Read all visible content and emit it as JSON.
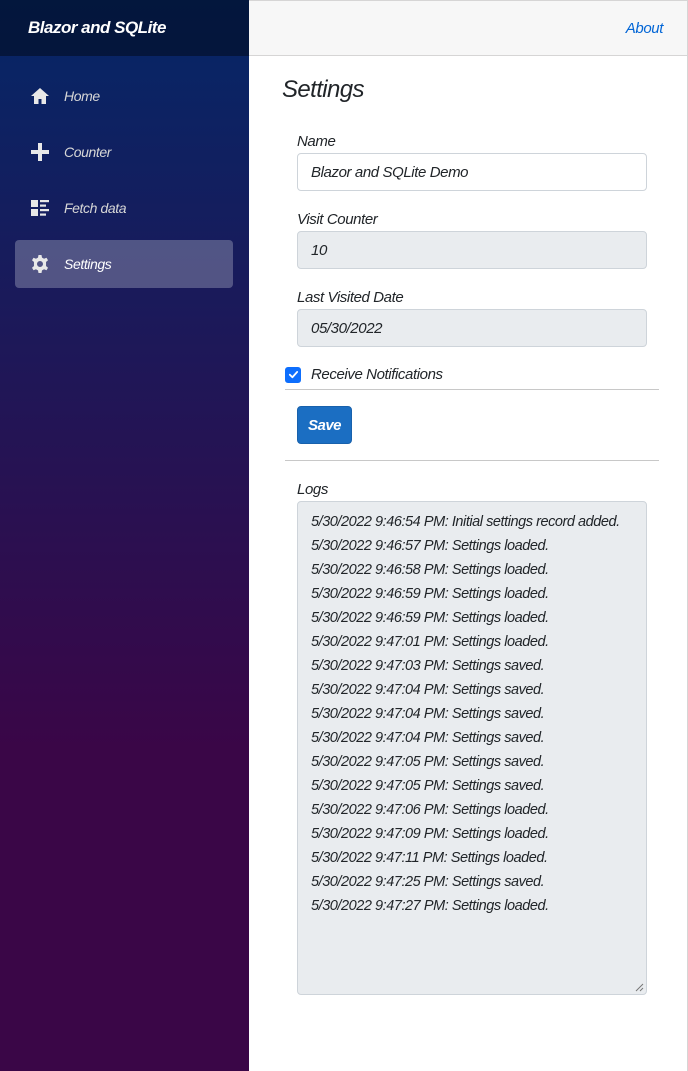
{
  "brand": "Blazor and SQLite",
  "nav": [
    {
      "label": "Home",
      "icon": "home-icon"
    },
    {
      "label": "Counter",
      "icon": "plus-icon"
    },
    {
      "label": "Fetch data",
      "icon": "list-rich-icon"
    },
    {
      "label": "Settings",
      "icon": "gear-icon",
      "active": true
    }
  ],
  "topbar": {
    "about": "About"
  },
  "page": {
    "title": "Settings"
  },
  "form": {
    "name_label": "Name",
    "name_value": "Blazor and SQLite Demo",
    "visit_label": "Visit Counter",
    "visit_value": "10",
    "date_label": "Last Visited Date",
    "date_value": "05/30/2022",
    "notifications_label": "Receive Notifications",
    "notifications_checked": true,
    "save_label": "Save"
  },
  "logs": {
    "label": "Logs",
    "lines": [
      "5/30/2022 9:46:54 PM: Initial settings record added.",
      "5/30/2022 9:46:57 PM: Settings loaded.",
      "5/30/2022 9:46:58 PM: Settings loaded.",
      "5/30/2022 9:46:59 PM: Settings loaded.",
      "5/30/2022 9:46:59 PM: Settings loaded.",
      "5/30/2022 9:47:01 PM: Settings loaded.",
      "5/30/2022 9:47:03 PM: Settings saved.",
      "5/30/2022 9:47:04 PM: Settings saved.",
      "5/30/2022 9:47:04 PM: Settings saved.",
      "5/30/2022 9:47:04 PM: Settings saved.",
      "5/30/2022 9:47:05 PM: Settings saved.",
      "5/30/2022 9:47:05 PM: Settings saved.",
      "5/30/2022 9:47:06 PM: Settings loaded.",
      "5/30/2022 9:47:09 PM: Settings loaded.",
      "5/30/2022 9:47:11 PM: Settings loaded.",
      "5/30/2022 9:47:25 PM: Settings saved.",
      "5/30/2022 9:47:27 PM: Settings loaded."
    ]
  },
  "colors": {
    "sidebar_top": "#052767",
    "sidebar_bottom": "#3a0647",
    "accent": "#1b6ec2",
    "link": "#0366d6"
  }
}
